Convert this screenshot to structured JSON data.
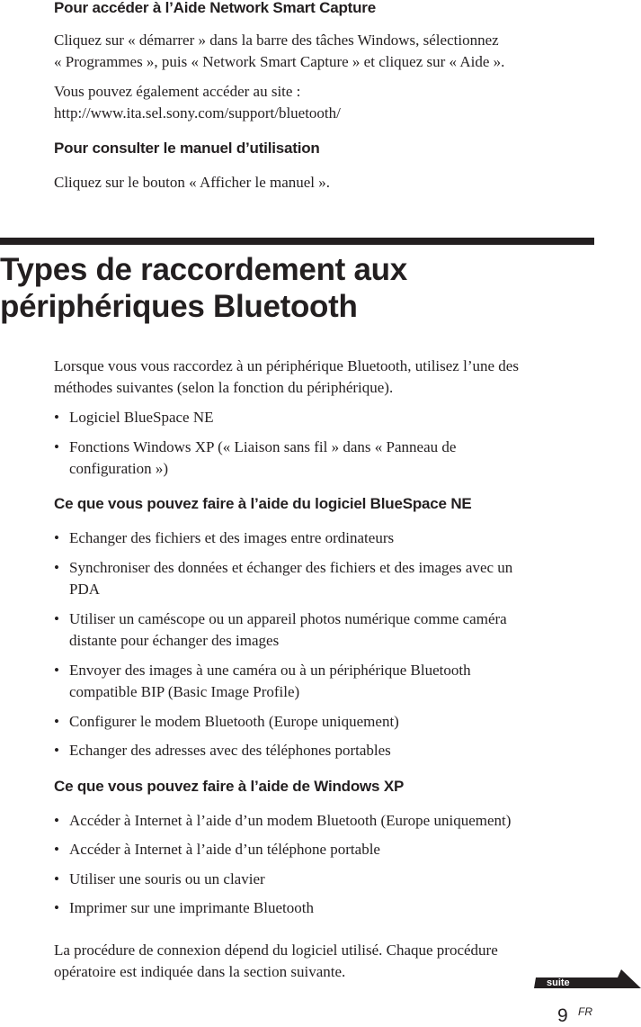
{
  "section_help": {
    "heading": "Pour accéder à l’Aide Network Smart Capture",
    "para1_line1": "Cliquez sur « démarrer » dans la barre des tâches Windows, sélectionnez",
    "para1_line2": "« Programmes », puis « Network Smart Capture » et cliquez sur « Aide ».",
    "para2_line1": "Vous pouvez également accéder au site :",
    "para2_line2": "http://www.ita.sel.sony.com/support/bluetooth/"
  },
  "section_manual": {
    "heading": "Pour consulter le manuel d’utilisation",
    "para": " Cliquez sur le bouton « Afficher le manuel »."
  },
  "chapter": {
    "title_line1": "Types de raccordement aux",
    "title_line2": "périphériques Bluetooth",
    "intro_line1": "Lorsque vous vous raccordez à un périphérique Bluetooth, utilisez l’une des",
    "intro_line2": "méthodes suivantes (selon la fonction du périphérique).",
    "methods": [
      {
        "lines": [
          "Logiciel BlueSpace NE"
        ]
      },
      {
        "lines": [
          "Fonctions Windows XP (« Liaison sans fil » dans « Panneau de",
          "configuration »)"
        ]
      }
    ]
  },
  "bluespace": {
    "heading": "Ce que vous pouvez faire à l’aide du logiciel BlueSpace NE",
    "items": [
      {
        "lines": [
          "Echanger des fichiers et des images entre ordinateurs"
        ]
      },
      {
        "lines": [
          "Synchroniser des données et échanger des fichiers et des images avec un",
          "PDA"
        ]
      },
      {
        "lines": [
          "Utiliser un caméscope ou un appareil photos numérique comme caméra",
          "distante pour échanger des images"
        ]
      },
      {
        "lines": [
          "Envoyer des images à une caméra ou à un périphérique Bluetooth",
          "compatible BIP (Basic Image Profile)"
        ]
      },
      {
        "lines": [
          "Configurer le modem Bluetooth (Europe uniquement)"
        ]
      },
      {
        "lines": [
          "Echanger des adresses avec des téléphones portables"
        ]
      }
    ]
  },
  "windowsxp": {
    "heading": "Ce que vous pouvez faire à l’aide de Windows XP",
    "items": [
      {
        "lines": [
          "Accéder à Internet à l’aide d’un modem Bluetooth (Europe uniquement)"
        ]
      },
      {
        "lines": [
          "Accéder à Internet à l’aide d’un téléphone portable"
        ]
      },
      {
        "lines": [
          "Utiliser une souris ou un clavier"
        ]
      },
      {
        "lines": [
          "Imprimer sur une imprimante Bluetooth"
        ]
      }
    ]
  },
  "closing": {
    "line1": "La procédure de connexion dépend du logiciel utilisé. Chaque procédure",
    "line2": "opératoire est indiquée dans la section suivante."
  },
  "footer": {
    "bullet_char": "•",
    "continue_label": "suite",
    "page_number": "9",
    "page_suffix": "FR"
  }
}
